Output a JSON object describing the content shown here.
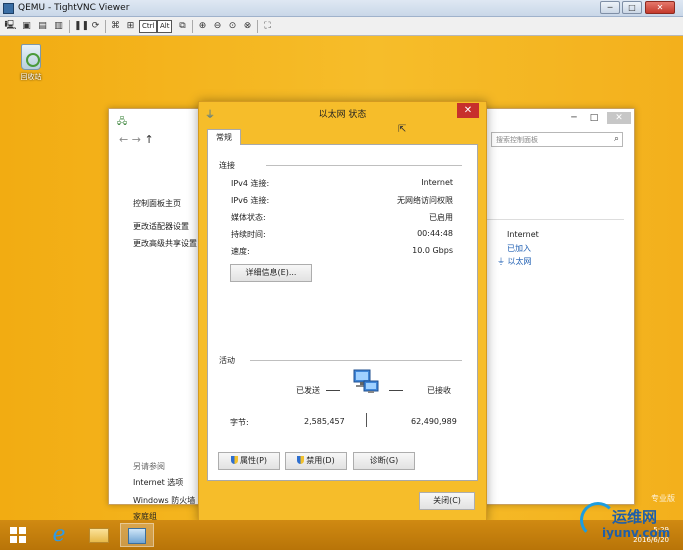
{
  "vnc": {
    "title": "QEMU - TightVNC Viewer",
    "ctrl_key": "Ctrl",
    "alt_key": "Alt",
    "minimize": "─",
    "maximize": "□",
    "close": "✕"
  },
  "desktop": {
    "recycle_bin_label": "回收站",
    "edition_text": "专业版"
  },
  "control_panel": {
    "search_placeholder": "搜索控制面板",
    "nav_back": "←",
    "nav_forward": "→",
    "nav_up": "↑",
    "left_links": [
      "控制面板主页",
      "更改适配器设置",
      "更改高级共享设置"
    ],
    "see_also_title": "另请参阅",
    "see_also_links": [
      "Internet 选项",
      "Windows 防火墙",
      "家庭组"
    ],
    "right_internet": "Internet",
    "right_joined": "已加入",
    "right_ethernet": "以太网",
    "right_dot": "."
  },
  "dialog": {
    "title": "以太网 状态",
    "close": "✕",
    "tab_general": "常规",
    "connection_section": "连接",
    "rows": [
      {
        "label": "IPv4 连接:",
        "value": "Internet"
      },
      {
        "label": "IPv6 连接:",
        "value": "无网络访问权限"
      },
      {
        "label": "媒体状态:",
        "value": "已启用"
      },
      {
        "label": "持续时间:",
        "value": "00:44:48"
      },
      {
        "label": "速度:",
        "value": "10.0 Gbps"
      }
    ],
    "details_button": "详细信息(E)...",
    "activity_section": "活动",
    "sent_label": "已发送",
    "received_label": "已接收",
    "bytes_label": "字节:",
    "bytes_sent": "2,585,457",
    "bytes_received": "62,490,989",
    "properties_button": "属性(P)",
    "disable_button": "禁用(D)",
    "diagnose_button": "诊断(G)",
    "close_button": "关闭(C)"
  },
  "taskbar": {
    "clock_time": "5:29",
    "clock_date": "2016/6/20"
  },
  "watermark": {
    "cn": "运维网",
    "url": "iyunv.com"
  },
  "colors": {
    "desktop": "#f6bd2a",
    "close_red": "#c7302c",
    "link_blue": "#1f5fb3"
  }
}
